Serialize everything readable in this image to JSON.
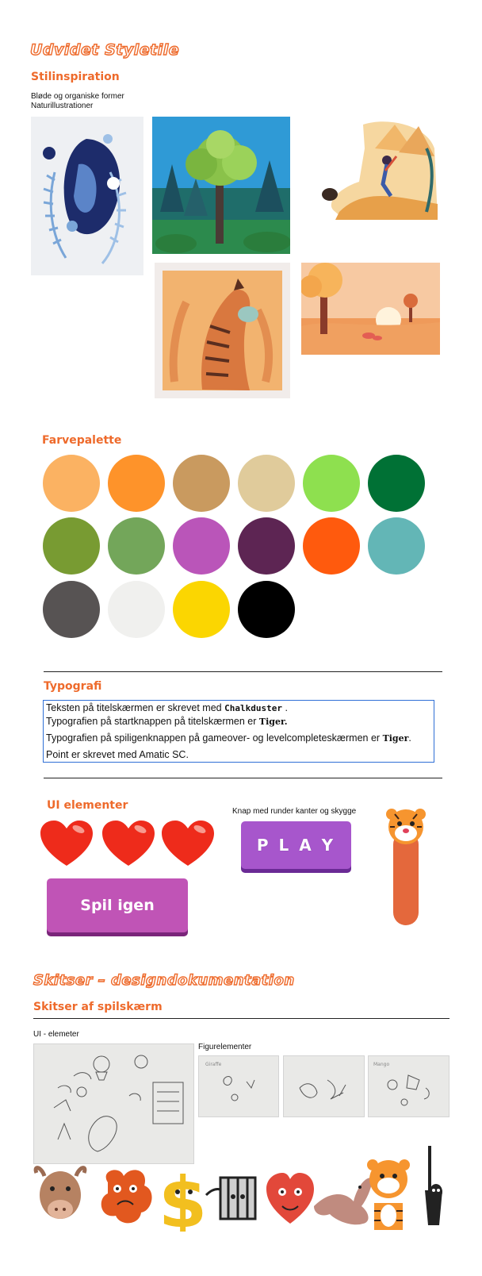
{
  "page_title": "Udvidet Styletile",
  "inspiration": {
    "heading": "Stilinspiration",
    "line1": "Bløde og organiske former",
    "line2": "Naturillustrationer"
  },
  "palette": {
    "heading": "Farvepalette",
    "colors": [
      "#fbb262",
      "#fe932a",
      "#c99a5f",
      "#e0cb9b",
      "#8ee04f",
      "#007135",
      "#789b32",
      "#73a65a",
      "#ba55b9",
      "#5d2553",
      "#ff5a0d",
      "#63b6b6",
      "#575353",
      "#f0f0ee",
      "#fbd601",
      "#000000"
    ]
  },
  "typography": {
    "heading": "Typografi",
    "l1_text": "Teksten på titelskærmen er skrevet med",
    "l1_font": "Chalkduster",
    "l2_text": "Typografien på startknappen på titelskærmen er",
    "l2_font": "Tiger.",
    "l3_text": "Typografien på spiligenknappen på gameover- og levelcompleteskærmen er",
    "l3_font": "Tiger",
    "l4_text": "Point er skrevet med Amatic SC."
  },
  "ui": {
    "heading": "UI elementer",
    "caption": "Knap med runder kanter og skygge",
    "play_label": "P L A Y",
    "retry_label": "Spil igen"
  },
  "sketches": {
    "heading": "Skitser – designdokumentation",
    "subheading": "Skitser af spilskærm",
    "ui_label": "UI - elemeter",
    "figure_label": "Figurelementer"
  }
}
